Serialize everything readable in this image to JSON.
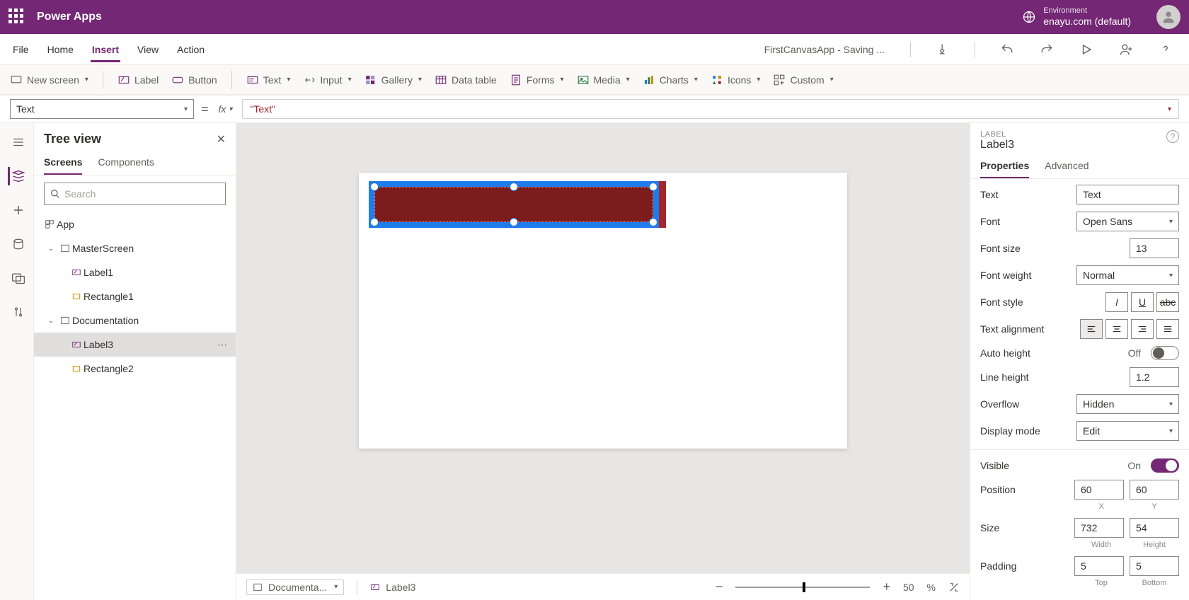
{
  "topbar": {
    "appName": "Power Apps",
    "envLabel": "Environment",
    "envName": "enayu.com (default)"
  },
  "menu": {
    "items": [
      "File",
      "Home",
      "Insert",
      "View",
      "Action"
    ],
    "activeIndex": 2,
    "status": "FirstCanvasApp - Saving ..."
  },
  "ribbon": {
    "newScreen": "New screen",
    "label": "Label",
    "button": "Button",
    "text": "Text",
    "input": "Input",
    "gallery": "Gallery",
    "dataTable": "Data table",
    "forms": "Forms",
    "media": "Media",
    "charts": "Charts",
    "icons": "Icons",
    "custom": "Custom"
  },
  "formula": {
    "property": "Text",
    "value": "\"Text\""
  },
  "tree": {
    "title": "Tree view",
    "tabs": [
      "Screens",
      "Components"
    ],
    "activeTab": 0,
    "searchPlaceholder": "Search",
    "app": "App",
    "screen1": "MasterScreen",
    "s1_label": "Label1",
    "s1_rect": "Rectangle1",
    "screen2": "Documentation",
    "s2_label": "Label3",
    "s2_rect": "Rectangle2"
  },
  "canvasFooter": {
    "screen": "Documenta...",
    "selected": "Label3",
    "zoom": "50",
    "zoomUnit": "%"
  },
  "props": {
    "type": "LABEL",
    "name": "Label3",
    "tabs": [
      "Properties",
      "Advanced"
    ],
    "activeTab": 0,
    "text": {
      "lbl": "Text",
      "val": "Text"
    },
    "font": {
      "lbl": "Font",
      "val": "Open Sans"
    },
    "fontSize": {
      "lbl": "Font size",
      "val": "13"
    },
    "fontWeight": {
      "lbl": "Font weight",
      "val": "Normal"
    },
    "fontStyle": {
      "lbl": "Font style"
    },
    "textAlign": {
      "lbl": "Text alignment"
    },
    "autoHeight": {
      "lbl": "Auto height",
      "val": "Off"
    },
    "lineHeight": {
      "lbl": "Line height",
      "val": "1.2"
    },
    "overflow": {
      "lbl": "Overflow",
      "val": "Hidden"
    },
    "displayMode": {
      "lbl": "Display mode",
      "val": "Edit"
    },
    "visible": {
      "lbl": "Visible",
      "val": "On"
    },
    "position": {
      "lbl": "Position",
      "x": "60",
      "y": "60",
      "xlbl": "X",
      "ylbl": "Y"
    },
    "size": {
      "lbl": "Size",
      "w": "732",
      "h": "54",
      "wlbl": "Width",
      "hlbl": "Height"
    },
    "padding": {
      "lbl": "Padding",
      "t": "5",
      "b": "5",
      "tlbl": "Top",
      "blbl": "Bottom"
    }
  }
}
